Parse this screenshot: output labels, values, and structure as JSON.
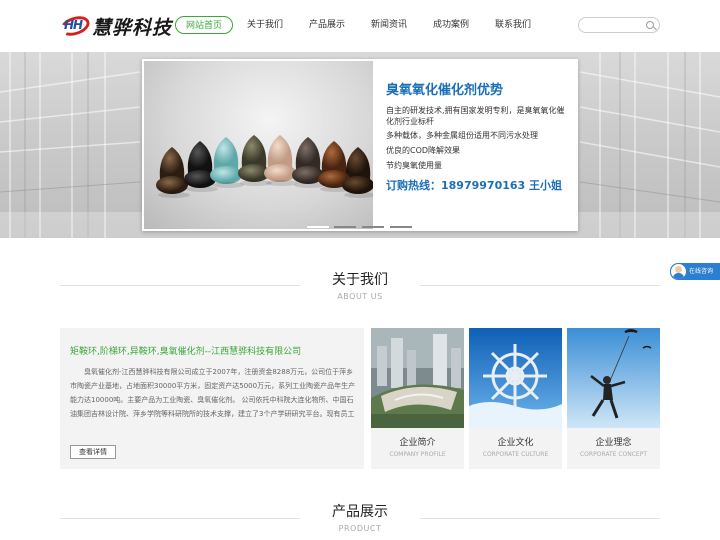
{
  "logo": {
    "mark": "HH",
    "text": "慧骅科技"
  },
  "nav": {
    "items": [
      {
        "label": "网站首页",
        "active": true
      },
      {
        "label": "关于我们",
        "active": false
      },
      {
        "label": "产品展示",
        "active": false
      },
      {
        "label": "新闻资讯",
        "active": false
      },
      {
        "label": "成功案例",
        "active": false
      },
      {
        "label": "联系我们",
        "active": false
      }
    ]
  },
  "search": {
    "placeholder": "",
    "value": ""
  },
  "banner": {
    "title": "臭氧氧化催化剂优势",
    "lines": [
      "自主的研发技术,拥有国家发明专利，是臭氧氧化催化剂行业标杆",
      "多种载体，多种金属组份适用不同污水处理",
      "优良的COD降解效果",
      "节约臭氧使用量"
    ],
    "hotline": "订购热线：18979970163  王小姐",
    "slide_count": 4,
    "active_slide": 1
  },
  "chat": {
    "label": "在线咨询"
  },
  "about": {
    "title": "关于我们",
    "subtitle": "ABOUT US",
    "heading": "矩鞍环,阶梯环,异鞍环,臭氧催化剂--江西慧骅科技有限公司",
    "body": "臭氧催化剂-江西慧骅科技有限公司成立于2007年，注册资金8288万元，公司位于萍乡市陶瓷产业基地，占地面积30000平方米，固定资产达5000万元，系列工业陶瓷产品年生产能力达10000吨。主要产品为工业陶瓷、臭氧催化剂。 公司依托中科院大连化物所、中国石油集团吉林设计院、萍乡学院等科研院所的技术支撑，建立了3个产学研研究平台。现有员工",
    "more_label": "查看详情",
    "cards": [
      {
        "label": "企业简介",
        "sub": "COMPANY PROFILE"
      },
      {
        "label": "企业文化",
        "sub": "CORPORATE CULTURE"
      },
      {
        "label": "企业理念",
        "sub": "CORPORATE CONCEPT"
      }
    ]
  },
  "products": {
    "title": "产品展示",
    "subtitle": "PRODUCT"
  },
  "colors": {
    "accent_green": "#3aa83a",
    "accent_blue": "#1a6fb8"
  }
}
